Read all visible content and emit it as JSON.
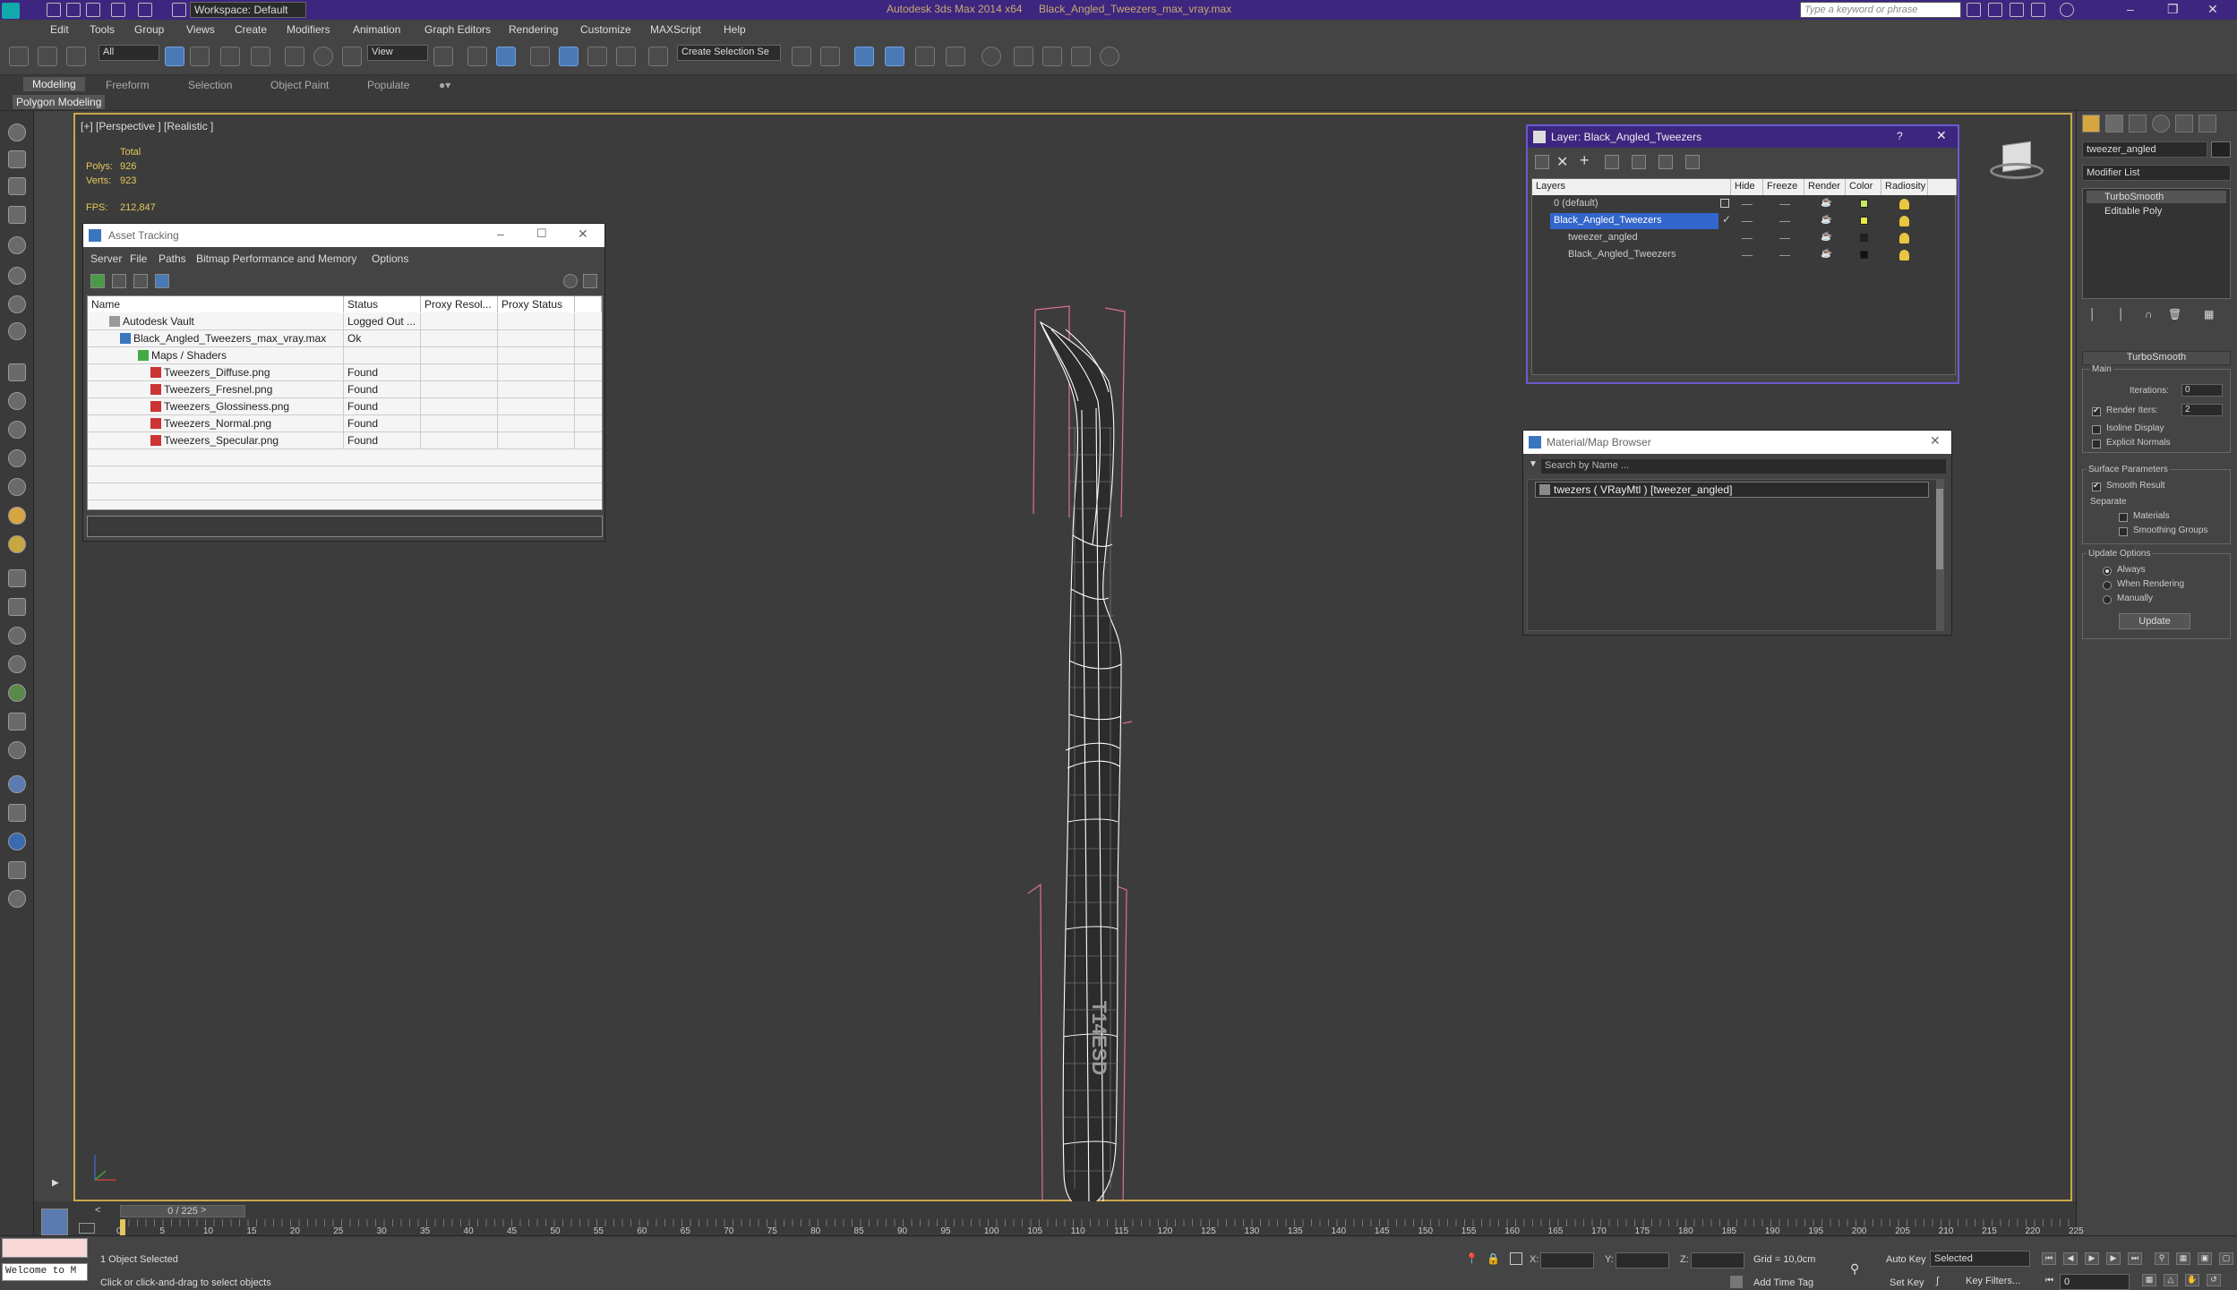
{
  "titlebar": {
    "app": "Autodesk 3ds Max  2014 x64",
    "file": "Black_Angled_Tweezers_max_vray.max",
    "workspace": "Workspace: Default",
    "search_placeholder": "Type a keyword or phrase"
  },
  "menu": [
    "Edit",
    "Tools",
    "Group",
    "Views",
    "Create",
    "Modifiers",
    "Animation",
    "Graph Editors",
    "Rendering",
    "Customize",
    "MAXScript",
    "Help"
  ],
  "toolbar": {
    "filter": "All",
    "ref_coord": "View",
    "selection_set": "Create Selection Se"
  },
  "ribbon": {
    "tabs": [
      "Modeling",
      "Freeform",
      "Selection",
      "Object Paint",
      "Populate"
    ],
    "sub": "Polygon Modeling"
  },
  "viewport": {
    "label": "[+] [Perspective ] [Realistic ]",
    "stats": {
      "total_label": "Total",
      "polys_label": "Polys:",
      "polys": "926",
      "verts_label": "Verts:",
      "verts": "923",
      "fps_label": "FPS:",
      "fps": "212,847"
    },
    "model_text": "T14ESD"
  },
  "asset_tracking": {
    "title": "Asset Tracking",
    "menu": [
      "Server",
      "File",
      "Paths",
      "Bitmap Performance and Memory",
      "Options"
    ],
    "columns": [
      "Name",
      "Status",
      "Proxy Resol...",
      "Proxy Status"
    ],
    "rows": [
      {
        "name": "Autodesk Vault",
        "status": "Logged Out ...",
        "icon": "vault"
      },
      {
        "name": "Black_Angled_Tweezers_max_vray.max",
        "status": "Ok",
        "icon": "doc"
      },
      {
        "name": "Maps / Shaders",
        "status": "",
        "icon": "map"
      },
      {
        "name": "Tweezers_Diffuse.png",
        "status": "Found",
        "icon": "png"
      },
      {
        "name": "Tweezers_Fresnel.png",
        "status": "Found",
        "icon": "png"
      },
      {
        "name": "Tweezers_Glossiness.png",
        "status": "Found",
        "icon": "png"
      },
      {
        "name": "Tweezers_Normal.png",
        "status": "Found",
        "icon": "png"
      },
      {
        "name": "Tweezers_Specular.png",
        "status": "Found",
        "icon": "png"
      }
    ]
  },
  "layer_dialog": {
    "title": "Layer: Black_Angled_Tweezers",
    "help": "?",
    "columns": [
      "Layers",
      "Hide",
      "Freeze",
      "Render",
      "Color",
      "Radiosity"
    ],
    "rows": [
      {
        "name": "0 (default)",
        "color": "#c8e860"
      },
      {
        "name": "Black_Angled_Tweezers",
        "color": "#e8e84a"
      },
      {
        "name": "tweezer_angled",
        "color": "#222222"
      },
      {
        "name": "Black_Angled_Tweezers",
        "color": "#111111"
      }
    ]
  },
  "material_browser": {
    "title": "Material/Map Browser",
    "search_placeholder": "Search by Name ...",
    "item": "twezers  ( VRayMtl ) [tweezer_angled]"
  },
  "command_panel": {
    "object_name": "tweezer_angled",
    "modifier_list": "Modifier List",
    "stack": [
      "TurboSmooth",
      "Editable Poly"
    ],
    "rollout_title": "TurboSmooth",
    "main_label": "Main",
    "iterations_label": "Iterations:",
    "iterations": "0",
    "render_iters_label": "Render Iters:",
    "render_iters": "2",
    "isoline": "Isoline Display",
    "explicit": "Explicit Normals",
    "surface_params": "Surface Parameters",
    "smooth_result": "Smooth Result",
    "separate": "Separate",
    "materials": "Materials",
    "smoothing_groups": "Smoothing Groups",
    "update_options": "Update Options",
    "always": "Always",
    "when_rendering": "When Rendering",
    "manually": "Manually",
    "update_button": "Update"
  },
  "timeline": {
    "slider": "0 / 225",
    "ticks": [
      "0",
      "5",
      "10",
      "15",
      "20",
      "25",
      "30",
      "35",
      "40",
      "45",
      "50",
      "55",
      "60",
      "65",
      "70",
      "75",
      "80",
      "85",
      "90",
      "95",
      "100",
      "105",
      "110",
      "115",
      "120",
      "125",
      "130",
      "135",
      "140",
      "145",
      "150",
      "155",
      "160",
      "165",
      "170",
      "175",
      "180",
      "185",
      "190",
      "195",
      "200",
      "205",
      "210",
      "215",
      "220",
      "225"
    ]
  },
  "status": {
    "welcome": "Welcome to M",
    "selected": "1 Object Selected",
    "prompt": "Click or click-and-drag to select objects",
    "x_label": "X:",
    "y_label": "Y:",
    "z_label": "Z:",
    "grid": "Grid = 10,0cm",
    "add_time_tag": "Add Time Tag",
    "auto_key": "Auto Key",
    "set_key": "Set Key",
    "selected_dropdown": "Selected",
    "key_filters": "Key Filters...",
    "frame": "0"
  }
}
